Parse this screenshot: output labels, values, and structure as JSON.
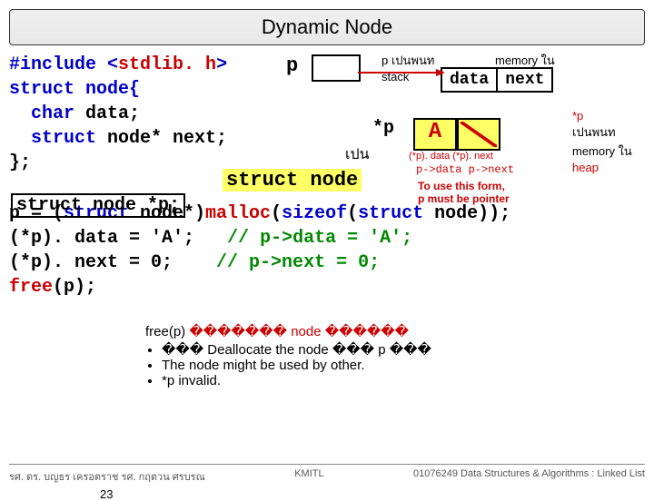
{
  "title": "Dynamic Node",
  "code": {
    "l1a": "#include <",
    "l1b": "stdlib. h",
    "l1c": ">",
    "l2": "struct node{",
    "l3a": "char",
    "l3b": " data;",
    "l4a": "struct",
    "l4b": " node* next;",
    "l5": "};",
    "struct_p": "struct node *p;",
    "l7a": "p = (",
    "l7b": "struct",
    "l7c": " node*)",
    "l7d": "malloc",
    "l7e": "(",
    "l7f": "sizeof",
    "l7g": "(",
    "l7h": "struct",
    "l7i": " node));",
    "l8a": "(*p). data = 'A';",
    "l8b": "// p->data = 'A';",
    "l9a": "(*p). next = 0;",
    "l9b": "// p->next = 0;",
    "l10a": "free",
    "l10b": "(p);"
  },
  "labels": {
    "p": "p",
    "p_annot": "p เปนพนท stack",
    "mem_annot": "memory ใน",
    "data_cell": "data",
    "next_cell": "next",
    "star_p": "*p",
    "A": "A",
    "pen": "เปน",
    "struct_node": "struct node",
    "star_p_annot": "*p\nเปนพนท memory ใน heap",
    "small1": "(*p). data (*p). next",
    "small2": "p->data   p->next",
    "use_note1": "To use this form,",
    "use_note2": "p must be pointer"
  },
  "free_notes": {
    "n0a": "free(p) ",
    "n0b": "������� node ������",
    "n1": "��� Deallocate the node ��� p ���",
    "n2": "The node might be used by other.",
    "n3": "*p invalid."
  },
  "footer": {
    "left": "รศ. ดร. บญธร    เครอตราช      รศ. กฤตวน  ศรบรณ",
    "mid": "KMITL",
    "right": "01076249 Data Structures & Algorithms : Linked List",
    "page": "23"
  }
}
